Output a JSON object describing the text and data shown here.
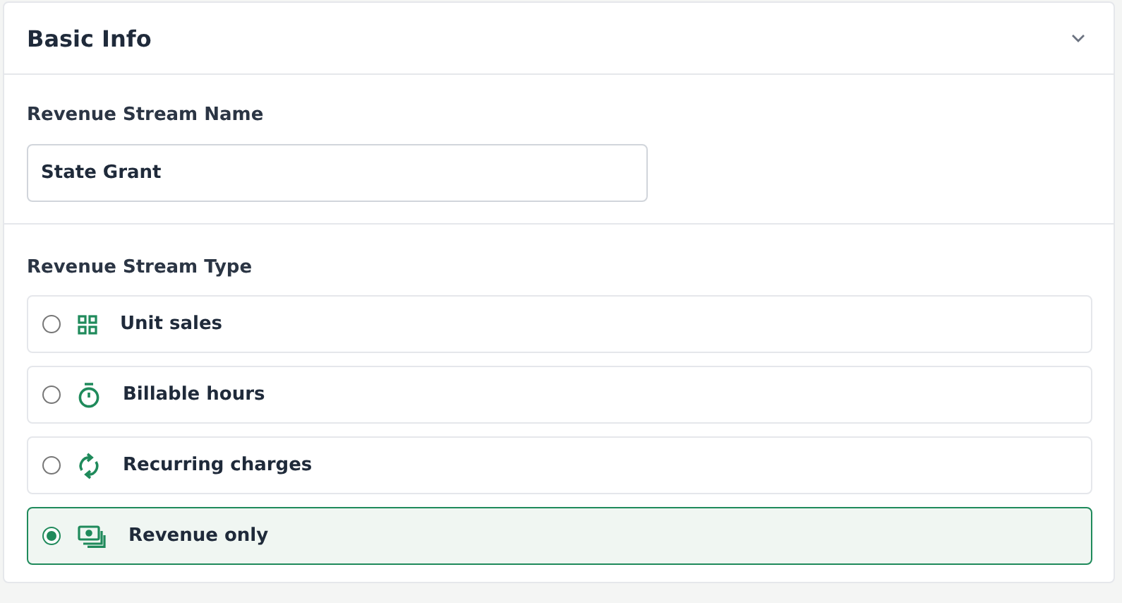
{
  "panel": {
    "title": "Basic Info",
    "expanded": true
  },
  "name_field": {
    "label": "Revenue Stream Name",
    "value": "State Grant"
  },
  "type_group": {
    "label": "Revenue Stream Type",
    "options": [
      {
        "label": "Unit sales",
        "kind": "units",
        "selected": false
      },
      {
        "label": "Billable hours",
        "kind": "hours",
        "selected": false
      },
      {
        "label": "Recurring charges",
        "kind": "recurring",
        "selected": false
      },
      {
        "label": "Revenue only",
        "kind": "revenue",
        "selected": true
      }
    ]
  }
}
